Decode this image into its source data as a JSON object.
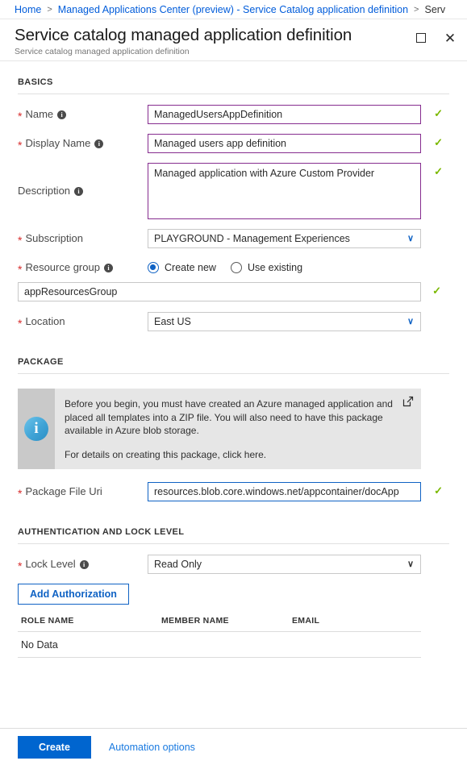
{
  "breadcrumb": {
    "items": [
      {
        "label": "Home"
      },
      {
        "label": "Managed Applications Center (preview) - Service Catalog application definition"
      },
      {
        "label": "Serv"
      }
    ],
    "separator": ">"
  },
  "blade": {
    "title": "Service catalog managed application definition",
    "subtitle": "Service catalog managed application definition",
    "maximize_icon": "maximize-icon",
    "close_icon": "close-icon"
  },
  "sections": {
    "basics": {
      "heading": "BASICS",
      "name": {
        "label": "Name",
        "required": "*",
        "value": "ManagedUsersAppDefinition",
        "valid": "✓"
      },
      "display_name": {
        "label": "Display Name",
        "required": "*",
        "value": "Managed users app definition",
        "valid": "✓"
      },
      "description": {
        "label": "Description",
        "value": "Managed application with Azure Custom Provider",
        "valid": "✓"
      },
      "subscription": {
        "label": "Subscription",
        "required": "*",
        "value": "PLAYGROUND - Management Experiences"
      },
      "resource_group": {
        "label": "Resource group",
        "required": "*",
        "options": [
          {
            "label": "Create new",
            "selected": true
          },
          {
            "label": "Use existing",
            "selected": false
          }
        ],
        "value": "appResourcesGroup",
        "valid": "✓"
      },
      "location": {
        "label": "Location",
        "required": "*",
        "value": "East US"
      }
    },
    "package": {
      "heading": "PACKAGE",
      "info": {
        "paragraph1": "Before you begin, you must have created an Azure managed application and placed all templates into a ZIP file. You will also need to have this package available in Azure blob storage.",
        "paragraph2": "For details on creating this package, click here.",
        "info_icon": "info-icon",
        "external_link_icon": "external-link-icon"
      },
      "package_file_uri": {
        "label": "Package File Uri",
        "required": "*",
        "value": "resources.blob.core.windows.net/appcontainer/docApp.zip",
        "valid": "✓"
      }
    },
    "auth": {
      "heading": "AUTHENTICATION AND LOCK LEVEL",
      "lock_level": {
        "label": "Lock Level",
        "required": "*",
        "value": "Read Only"
      },
      "add_authorization_label": "Add Authorization",
      "table": {
        "columns": [
          "ROLE NAME",
          "MEMBER NAME",
          "EMAIL"
        ],
        "empty_text": "No Data",
        "rows": []
      }
    }
  },
  "footer": {
    "create_label": "Create",
    "automation_label": "Automation options"
  },
  "glyphs": {
    "info": "i",
    "caret_down": "∨",
    "check": "✓"
  },
  "colors": {
    "accent_blue": "#0065cf",
    "link_blue": "#015cda",
    "valid_purple": "#862d8f",
    "focus_blue": "#0f62c4",
    "check_green": "#7ab800",
    "required_red": "#d72c2c"
  }
}
